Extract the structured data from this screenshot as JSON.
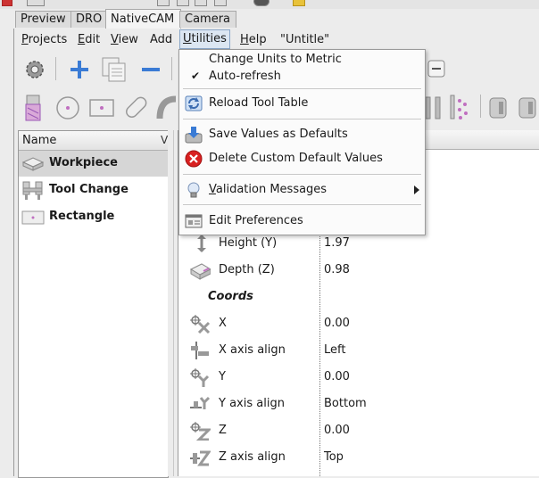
{
  "tabs": [
    {
      "label": "Preview",
      "active": false
    },
    {
      "label": "DRO",
      "active": false
    },
    {
      "label": "NativeCAM",
      "active": true
    },
    {
      "label": "Camera",
      "active": false
    }
  ],
  "menubar": {
    "projects": {
      "u": "P",
      "rest": "rojects"
    },
    "edit": {
      "u": "E",
      "rest": "dit"
    },
    "view": {
      "u": "V",
      "rest": "iew"
    },
    "add": {
      "u": "",
      "rest": "Add"
    },
    "utilities": {
      "u": "U",
      "rest": "tilities"
    },
    "help": {
      "u": "H",
      "rest": "elp"
    },
    "project_name": "\"Untitle\""
  },
  "dropdown": {
    "change_units": "Change Units to Metric",
    "auto_refresh": "Auto-refresh",
    "auto_refresh_checked": "✔",
    "reload_tool_table": "Reload Tool Table",
    "save_defaults": "Save Values as Defaults",
    "delete_defaults": "Delete Custom Default Values",
    "validation_u": "V",
    "validation_rest": "alidation Messages",
    "edit_preferences": "Edit Preferences"
  },
  "tree": {
    "header": "Name",
    "header2": "V",
    "items": [
      {
        "label": "Workpiece",
        "selected": true
      },
      {
        "label": "Tool Change",
        "selected": false
      },
      {
        "label": "Rectangle",
        "selected": false
      }
    ]
  },
  "props": {
    "rows": [
      {
        "name": "Height (Y)",
        "value": "1.97",
        "icon": "height-icon"
      },
      {
        "name": "Depth (Z)",
        "value": "0.98",
        "icon": "depth-icon"
      },
      {
        "section": "Coords"
      },
      {
        "name": "X",
        "value": "0.00",
        "icon": "x-coord-icon"
      },
      {
        "name": "X axis align",
        "value": "Left",
        "icon": "x-align-icon"
      },
      {
        "name": "Y",
        "value": "0.00",
        "icon": "y-coord-icon"
      },
      {
        "name": "Y axis align",
        "value": "Bottom",
        "icon": "y-align-icon"
      },
      {
        "name": "Z",
        "value": "0.00",
        "icon": "z-coord-icon"
      },
      {
        "name": "Z axis align",
        "value": "Top",
        "icon": "z-align-icon"
      }
    ]
  },
  "colors": {
    "menu_highlight": "#dce6f2",
    "selection": "#d6d6d6",
    "toolbar_blue": "#3a7bd5",
    "delete_red": "#d92020"
  }
}
